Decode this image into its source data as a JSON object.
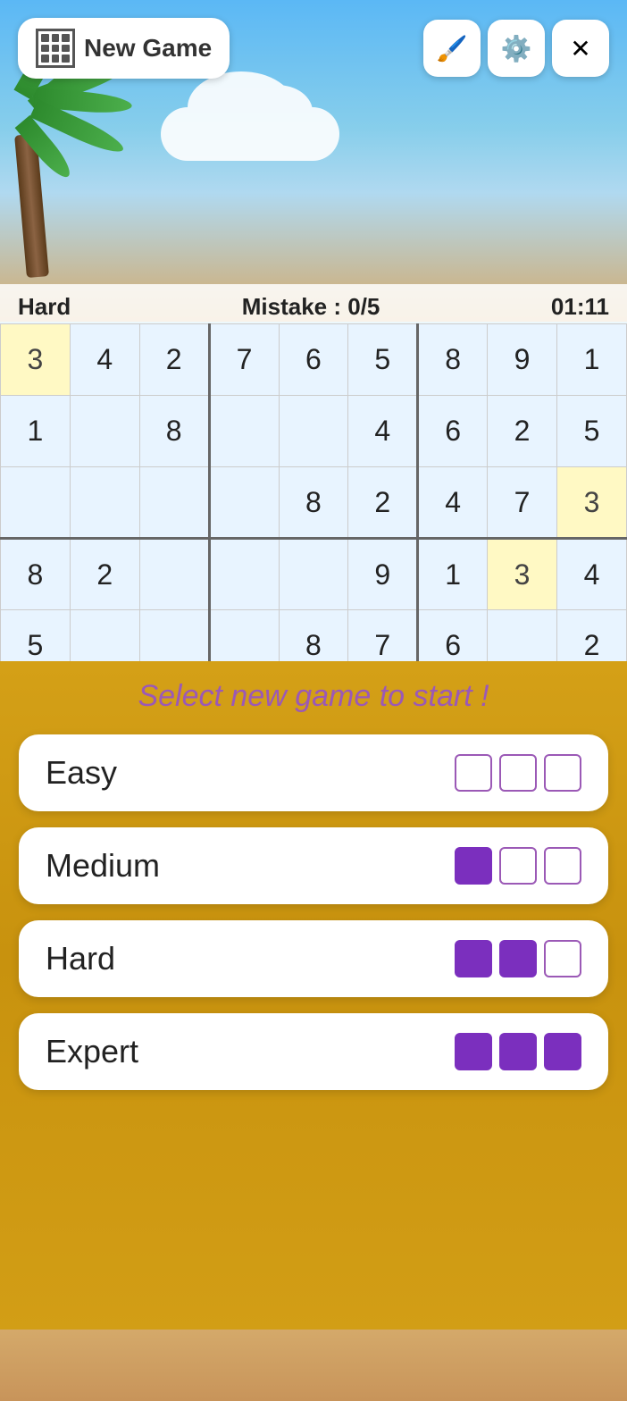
{
  "header": {
    "new_game_label": "New Game",
    "brush_icon": "🖌️",
    "settings_icon": "⚙️",
    "close_icon": "✕"
  },
  "status": {
    "difficulty": "Hard",
    "mistake_label": "Mistake : 0/5",
    "timer": "01:11"
  },
  "grid": {
    "rows": [
      [
        "3",
        "4",
        "2",
        "7",
        "6",
        "5",
        "8",
        "9",
        "1"
      ],
      [
        "1",
        "",
        "8",
        "",
        "",
        "4",
        "6",
        "2",
        "5"
      ],
      [
        "",
        "",
        "",
        "",
        "8",
        "2",
        "4",
        "7",
        "3"
      ],
      [
        "8",
        "2",
        "",
        "",
        "",
        "9",
        "1",
        "3",
        "4"
      ],
      [
        "5",
        "",
        "",
        "",
        "8",
        "7",
        "6",
        "",
        "2"
      ]
    ],
    "highlighted_cells": [
      [
        0,
        0
      ],
      [
        2,
        8
      ],
      [
        3,
        7
      ]
    ]
  },
  "overlay": {
    "prompt": "Select new game to start !",
    "difficulties": [
      {
        "label": "Easy",
        "filled_dots": 0,
        "total_dots": 3
      },
      {
        "label": "Medium",
        "filled_dots": 1,
        "total_dots": 3
      },
      {
        "label": "Hard",
        "filled_dots": 2,
        "total_dots": 3
      },
      {
        "label": "Expert",
        "filled_dots": 3,
        "total_dots": 3
      }
    ]
  }
}
